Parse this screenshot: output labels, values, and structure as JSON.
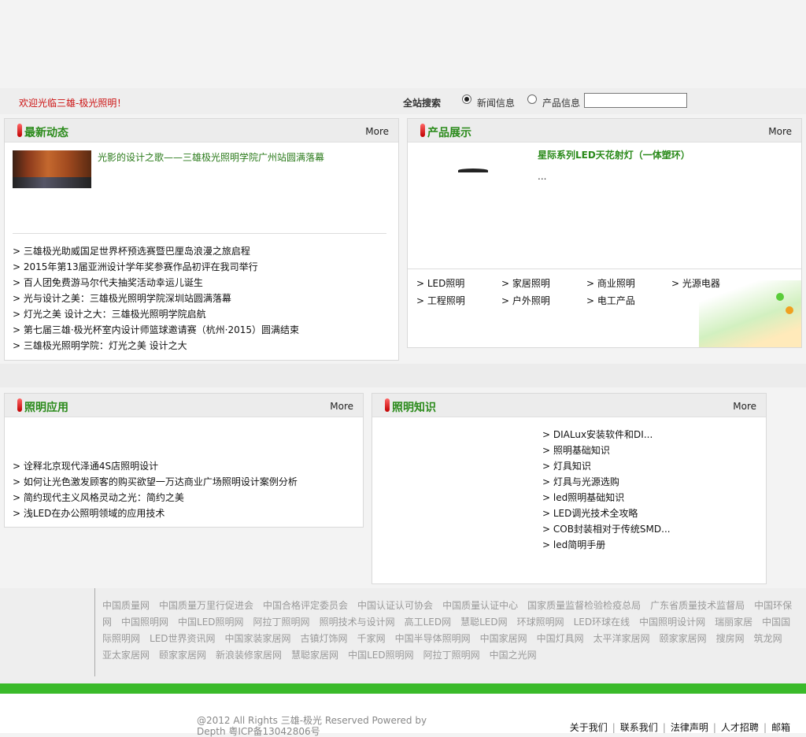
{
  "header": {
    "welcome": "欢迎光临三雄-极光照明！",
    "search_label": "全站搜索",
    "radio_news": "新闻信息",
    "radio_products": "产品信息"
  },
  "news": {
    "title": "最新动态",
    "more": "More",
    "headline": "光影的设计之歌——三雄极光照明学院广州站圆满落幕",
    "items": [
      "> 三雄极光助威国足世界杯预选赛暨巴厘岛浪漫之旅启程",
      "> 2015年第13届亚洲设计学年奖参赛作品初评在我司举行",
      "> 百人团免费游马尔代夫抽奖活动幸运儿诞生",
      "> 光与设计之美：三雄极光照明学院深圳站圆满落幕",
      "> 灯光之美 设计之大：三雄极光照明学院启航",
      "> 第七届三雄·极光杯室内设计师篮球邀请赛（杭州·2015）圆满结束",
      "> 三雄极光照明学院：灯光之美 设计之大"
    ]
  },
  "products": {
    "title": "产品展示",
    "more": "More",
    "name": "星际系列LED天花射灯（一体塑环）",
    "desc": "...",
    "categories": [
      "> LED照明",
      "> 家居照明",
      "> 商业照明",
      "> 光源电器",
      "> 工程照明",
      "> 户外照明",
      "> 电工产品"
    ]
  },
  "applications": {
    "title": "照明应用",
    "more": "More",
    "items": [
      "> 诠释北京现代泽通4S店照明设计",
      "> 如何让光色激发顾客的购买欲望一万达商业广场照明设计案例分析",
      "> 简约现代主义风格灵动之光：简约之美",
      "> 浅LED在办公照明领域的应用技术"
    ]
  },
  "knowledge": {
    "title": "照明知识",
    "more": "More",
    "items": [
      "> DIALux安装软件和DI...",
      "> 照明基础知识",
      "> 灯具知识",
      "> 灯具与光源选购",
      "> led照明基础知识",
      "> LED调光技术全攻略",
      "> COB封装相对于传统SMD...",
      "> led简明手册"
    ]
  },
  "footer": {
    "links": [
      "中国质量网",
      "中国质量万里行促进会",
      "中国合格评定委员会",
      "中国认证认可协会",
      "中国质量认证中心",
      "国家质量监督检验检疫总局",
      "广东省质量技术监督局",
      "中国环保网",
      "中国照明网",
      "中国LED照明网",
      "阿拉丁照明网",
      "照明技术与设计网",
      "高工LED网",
      "慧聪LED网",
      "环球照明网",
      "LED环球在线",
      "中国照明设计网",
      "瑞丽家居",
      "中国国际照明网",
      "LED世界资讯网",
      "中国家装家居网",
      "古镇灯饰网",
      "千家网",
      "中国半导体照明网",
      "中国家居网",
      "中国灯具网",
      "太平洋家居网",
      "颐家家居网",
      "搜房网",
      "筑龙网",
      "亚太家居网",
      "颐家家居网",
      "新浪装修家居网",
      "慧聪家居网",
      "中国LED照明网",
      "阿拉丁照明网",
      "中国之光网"
    ],
    "copyright": "@2012 All Rights 三雄-极光 Reserved Powered by Depth 粤ICP备13042806号",
    "nav": [
      "关于我们",
      "联系我们",
      "法律声明",
      "人才招聘",
      "邮箱"
    ]
  }
}
